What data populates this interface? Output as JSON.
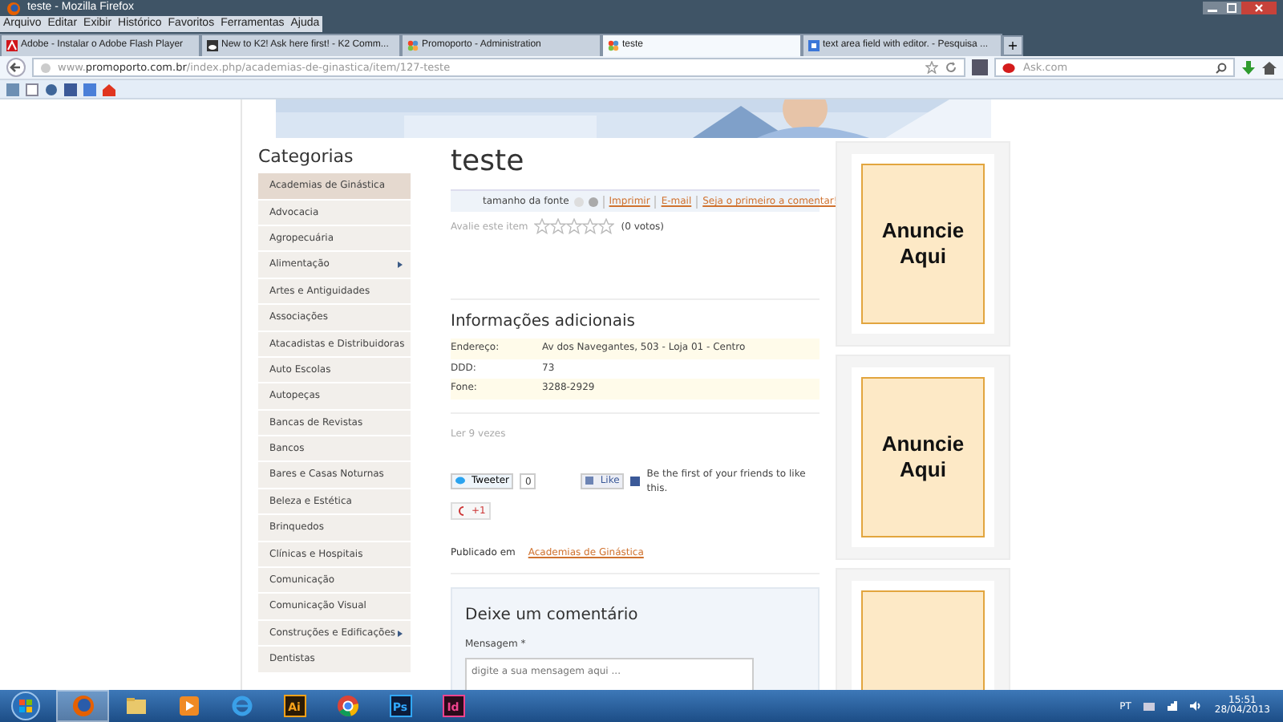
{
  "window": {
    "title": "teste - Mozilla Firefox"
  },
  "menu": [
    "Arquivo",
    "Editar",
    "Exibir",
    "Histórico",
    "Favoritos",
    "Ferramentas",
    "Ajuda"
  ],
  "tabs": [
    {
      "title": "Adobe - Instalar o Adobe Flash Player",
      "selected": false,
      "kind": "adobe"
    },
    {
      "title": "New to K2! Ask here first! - K2 Comm...",
      "selected": false,
      "kind": "cloud"
    },
    {
      "title": "Promoporto - Administration",
      "selected": false,
      "kind": "joomla"
    },
    {
      "title": "teste",
      "selected": true,
      "kind": "joomla"
    },
    {
      "title": "text area field with editor. - Pesquisa ...",
      "selected": false,
      "kind": "google"
    }
  ],
  "new_tab": "+",
  "address": {
    "url": "www.**promoporto.com.br**/index.php/academias-de-ginastica/item/127-teste"
  },
  "search": {
    "placeholder": "Ask.com"
  },
  "sidebar": {
    "heading": "Categorias",
    "items": [
      {
        "label": "Academias de Ginástica",
        "selected": true,
        "has_submenu": false
      },
      {
        "label": "Advocacia",
        "selected": false,
        "has_submenu": false
      },
      {
        "label": "Agropecuária",
        "selected": false,
        "has_submenu": false
      },
      {
        "label": "Alimentação",
        "selected": false,
        "has_submenu": true
      },
      {
        "label": "Artes e Antiguidades",
        "selected": false,
        "has_submenu": false
      },
      {
        "label": "Associações",
        "selected": false,
        "has_submenu": false
      },
      {
        "label": "Atacadistas e Distribuidoras",
        "selected": false,
        "has_submenu": false
      },
      {
        "label": "Auto Escolas",
        "selected": false,
        "has_submenu": false
      },
      {
        "label": "Autopeças",
        "selected": false,
        "has_submenu": false
      },
      {
        "label": "Bancas de Revistas",
        "selected": false,
        "has_submenu": false
      },
      {
        "label": "Bancos",
        "selected": false,
        "has_submenu": false
      },
      {
        "label": "Bares e Casas Noturnas",
        "selected": false,
        "has_submenu": false
      },
      {
        "label": "Beleza e Estética",
        "selected": false,
        "has_submenu": false
      },
      {
        "label": "Brinquedos",
        "selected": false,
        "has_submenu": false
      },
      {
        "label": "Clínicas e Hospitais",
        "selected": false,
        "has_submenu": false
      },
      {
        "label": "Comunicação",
        "selected": false,
        "has_submenu": false
      },
      {
        "label": "Comunicação Visual",
        "selected": false,
        "has_submenu": false
      },
      {
        "label": "Construções e Edificações",
        "selected": false,
        "has_submenu": true
      },
      {
        "label": "Dentistas",
        "selected": false,
        "has_submenu": false
      }
    ]
  },
  "article": {
    "title": "teste",
    "toolbar": {
      "font_size_label": "tamanho da fonte",
      "links": [
        "Imprimir",
        "E-mail",
        "Seja o primeiro a comentar!"
      ]
    },
    "rating": {
      "label": "Avalie este item",
      "stars": 0,
      "votes": "(0 votos)"
    },
    "info": {
      "heading": "Informações adicionais",
      "rows": [
        {
          "label": "Endereço:",
          "value": "Av dos Navegantes, 503 - Loja 01 - Centro"
        },
        {
          "label": "DDD:",
          "value": "73"
        },
        {
          "label": "Fone:",
          "value": "3288-2929"
        }
      ]
    },
    "reads": "Ler 9 vezes",
    "social": {
      "tweet": "Tweeter",
      "tweet_count": "0",
      "like": "Like",
      "like_text": "Be the first of your friends to like this.",
      "plus_one": "+1"
    },
    "published": {
      "label": "Publicado em",
      "category": "Academias de Ginástica"
    },
    "comment": {
      "heading": "Deixe um comentário",
      "message_label": "Mensagem *",
      "placeholder": "digite a sua mensagem aqui ..."
    }
  },
  "ads": [
    {
      "kind": "full",
      "text": "Anuncie Aqui"
    },
    {
      "kind": "full",
      "text": "Anuncie Aqui"
    },
    {
      "kind": "cut"
    }
  ],
  "taskbar": {
    "apps": [
      {
        "kind": "firefox",
        "selected": true
      },
      {
        "kind": "folder",
        "selected": false
      },
      {
        "kind": "media",
        "selected": false
      },
      {
        "kind": "ie",
        "selected": false
      },
      {
        "kind": "ai",
        "label": "Ai",
        "selected": false
      },
      {
        "kind": "chrome",
        "selected": false
      },
      {
        "kind": "ps",
        "label": "Ps",
        "selected": false
      },
      {
        "kind": "id",
        "label": "Id",
        "selected": false
      }
    ],
    "language": "PT",
    "time": "15:51",
    "date": "28/04/2013"
  }
}
